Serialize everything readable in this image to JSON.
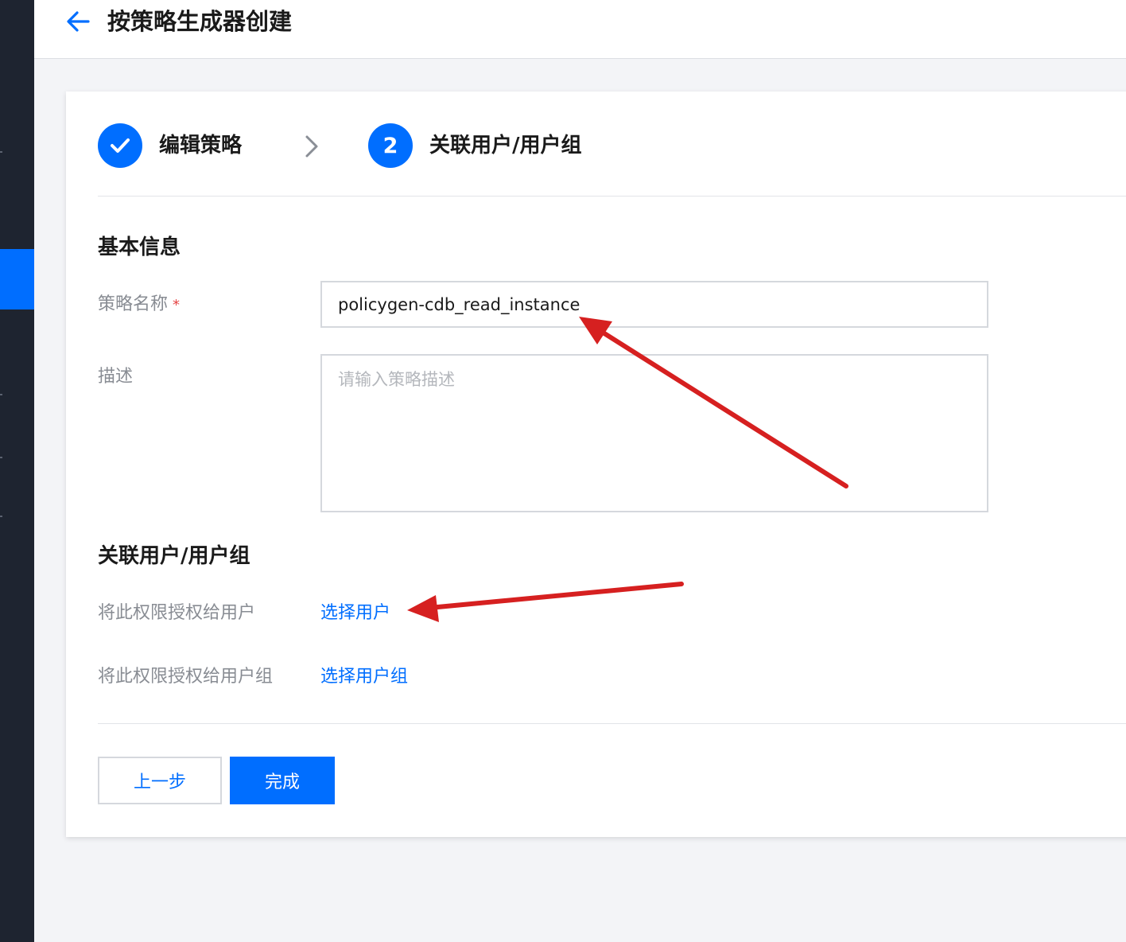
{
  "header": {
    "title": "按策略生成器创建",
    "back_icon": "arrow-left-icon"
  },
  "steps": [
    {
      "index": "",
      "label": "编辑策略",
      "status": "done",
      "icon": "check-icon"
    },
    {
      "index": "2",
      "label": "关联用户/用户组",
      "status": "active"
    }
  ],
  "basic_info": {
    "title": "基本信息",
    "name_label": "策略名称",
    "required_mark": "*",
    "name_value": "policygen-cdb_read_instance",
    "desc_label": "描述",
    "desc_placeholder": "请输入策略描述"
  },
  "association": {
    "title": "关联用户/用户组",
    "user_label": "将此权限授权给用户",
    "user_link": "选择用户",
    "group_label": "将此权限授权给用户组",
    "group_link": "选择用户组"
  },
  "buttons": {
    "prev": "上一步",
    "finish": "完成"
  },
  "colors": {
    "primary": "#006eff",
    "sidebar": "#1e2430",
    "annotation_arrow": "#d62020",
    "required": "#e54545"
  }
}
